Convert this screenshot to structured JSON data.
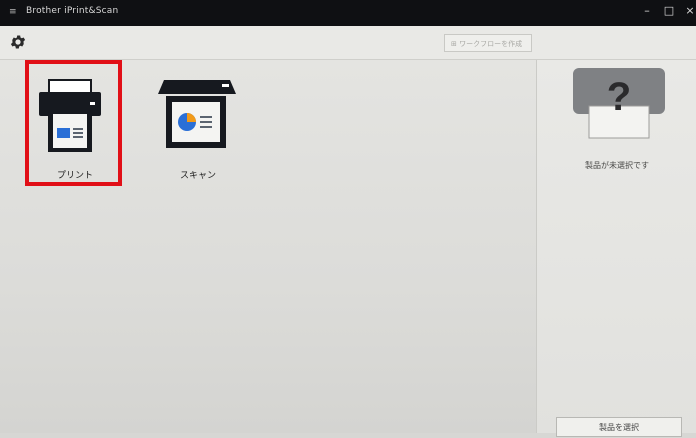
{
  "window": {
    "title": "Brother iPrint&Scan",
    "minimize_glyph": "–",
    "maximize_glyph": "□",
    "close_glyph": "×"
  },
  "toolbar": {
    "settings_icon": "gear-icon",
    "workflow_button_label": "ワークフローを作成"
  },
  "tiles": [
    {
      "label": "プリント",
      "icon": "printer-icon",
      "selected": true
    },
    {
      "label": "スキャン",
      "icon": "scanner-icon",
      "selected": false
    }
  ],
  "right_panel": {
    "device_icon": "unknown-device-icon",
    "status_text": "製品が未選択です",
    "select_button_label": "製品を選択"
  },
  "colors": {
    "highlight": "#e10f17",
    "icon_dark": "#16191f",
    "scan_blue": "#2a6fd6",
    "scan_orange": "#f29a18"
  }
}
